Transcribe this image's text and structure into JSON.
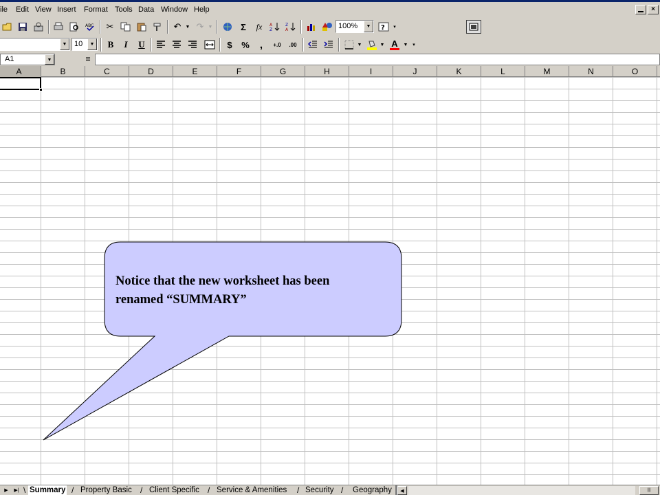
{
  "menu": {
    "items": [
      {
        "label": "File",
        "display": "ile"
      },
      {
        "label": "Edit"
      },
      {
        "label": "View"
      },
      {
        "label": "Insert"
      },
      {
        "label": "Format"
      },
      {
        "label": "Tools"
      },
      {
        "label": "Data"
      },
      {
        "label": "Window"
      },
      {
        "label": "Help"
      }
    ]
  },
  "toolbar_standard": {
    "zoom": "100%",
    "autosum_glyph": "Σ",
    "function_glyph": "fx"
  },
  "toolbar_formatting": {
    "font_name": "",
    "font_size": "10",
    "bold": "B",
    "italic": "I",
    "underline": "U",
    "currency": "$",
    "percent": "%",
    "comma": ",",
    "increase_decimal": "+.0",
    "decrease_decimal": ".00",
    "font_color_glyph": "A"
  },
  "formula_bar": {
    "name_box": "A1",
    "equals": "=",
    "value": ""
  },
  "columns": [
    "A",
    "B",
    "C",
    "D",
    "E",
    "F",
    "G",
    "H",
    "I",
    "J",
    "K",
    "L",
    "M",
    "N",
    "O"
  ],
  "active_cell": "A1",
  "sheet_tabs": [
    {
      "label": "Summary",
      "active": true
    },
    {
      "label": "Property Basic"
    },
    {
      "label": "Client Specific"
    },
    {
      "label": "Service & Amenities"
    },
    {
      "label": "Security"
    },
    {
      "label": "Geography"
    }
  ],
  "callout": {
    "line1": "Notice that the new worksheet has been",
    "line2": "renamed “SUMMARY”",
    "fill": "#ccccff",
    "stroke": "#000000"
  }
}
